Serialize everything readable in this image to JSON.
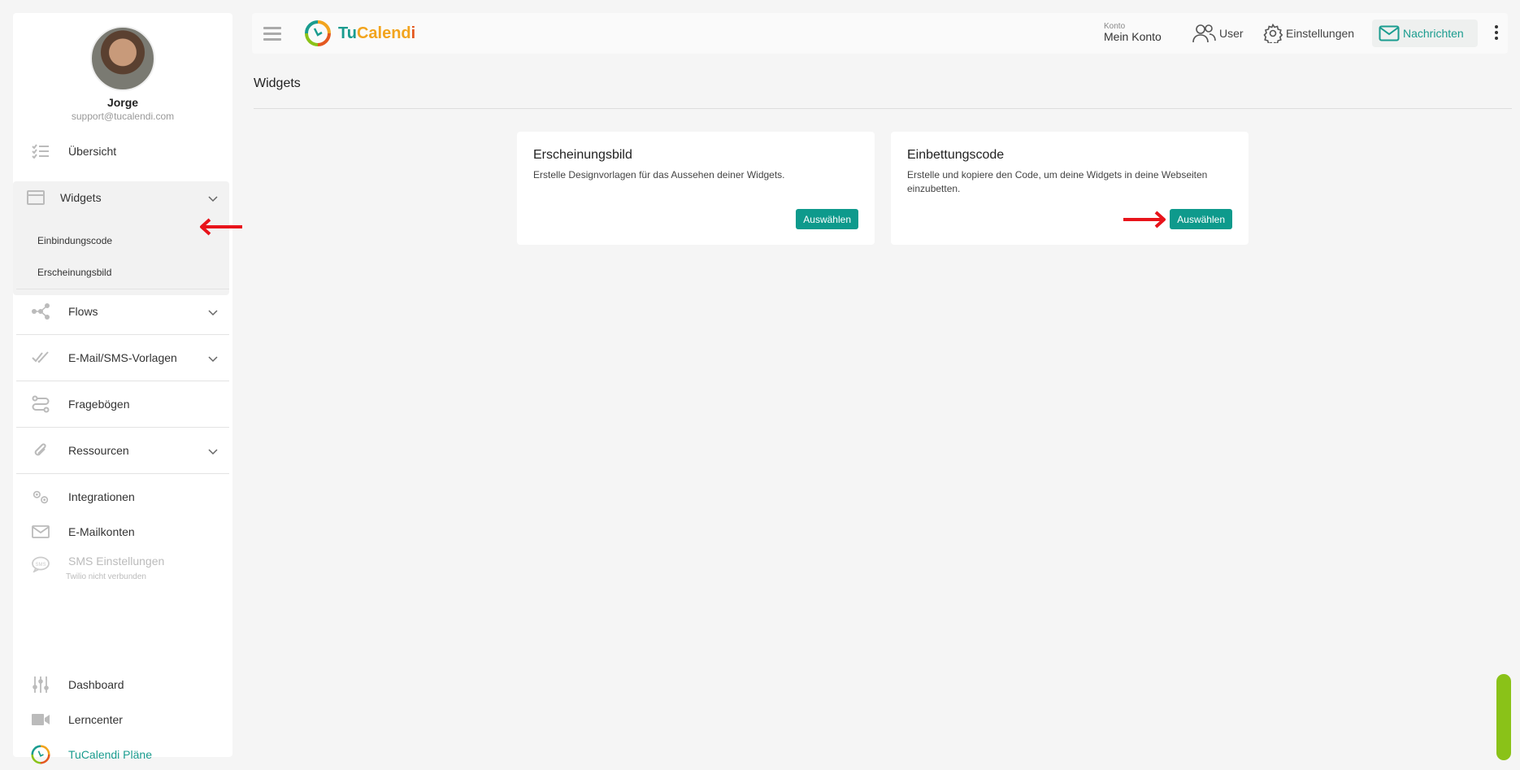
{
  "profile": {
    "name": "Jorge",
    "email": "support@tucalendi.com"
  },
  "sidebar": {
    "overview": "Übersicht",
    "widgets": "Widgets",
    "widgets_sub": [
      "Einbindungscode",
      "Erscheinungsbild"
    ],
    "flows": "Flows",
    "templates": "E-Mail/SMS-Vorlagen",
    "questionnaires": "Fragebögen",
    "resources": "Ressourcen",
    "integrations": "Integrationen",
    "email_accounts": "E-Mailkonten",
    "sms_settings": "SMS Einstellungen",
    "sms_status": "Twilio nicht verbunden",
    "dashboard": "Dashboard",
    "learncenter": "Lerncenter",
    "plans": "TuCalendi Pläne"
  },
  "topbar": {
    "logo_tu": "Tu",
    "logo_calend": "Calend",
    "logo_i": "i",
    "account_label": "Konto",
    "account_value": "Mein Konto",
    "user": "User",
    "settings": "Einstellungen",
    "messages": "Nachrichten"
  },
  "main": {
    "title": "Widgets",
    "cards": [
      {
        "title": "Erscheinungsbild",
        "desc": "Erstelle Designvorlagen für das Aussehen deiner Widgets.",
        "button": "Auswählen"
      },
      {
        "title": "Einbettungscode",
        "desc": "Erstelle und kopiere den Code, um deine Widgets in deine Webseiten einzubetten.",
        "button": "Auswählen"
      }
    ]
  },
  "colors": {
    "accent": "#0e9a8c",
    "arrow": "#e8141b",
    "scroll": "#8ac218"
  }
}
